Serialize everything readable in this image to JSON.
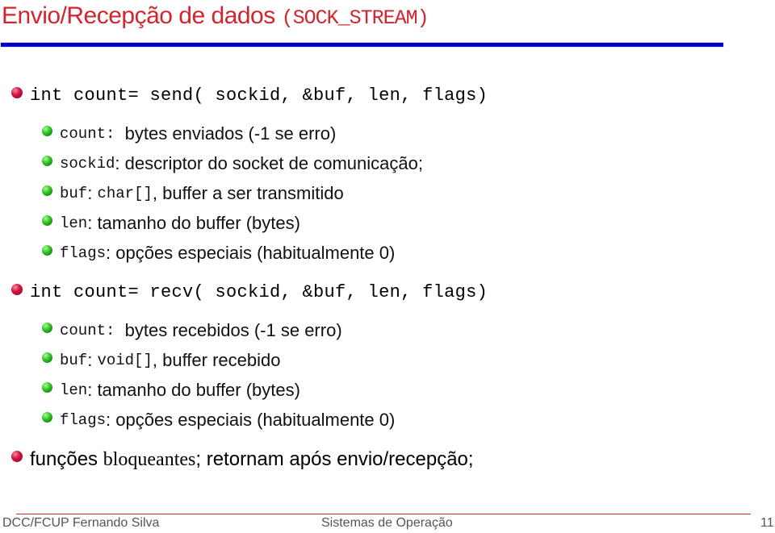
{
  "slide": {
    "title_text": "Envio/Recepção de dados ",
    "title_code": "(SOCK_STREAM)",
    "colors": {
      "title": "#d0262f",
      "rule": "#0000c8",
      "footer_rule": "#d0262f",
      "bullet_level1": "#c8103e",
      "bullet_level2": "#2fbf20"
    },
    "send": {
      "signature": "int count= send( sockid, &buf, len, flags)",
      "items": [
        {
          "code": "count:",
          "text": "  bytes enviados (-1 se erro)"
        },
        {
          "code": "sockid",
          "text": ": descriptor do socket de comunicação;"
        },
        {
          "code": "buf",
          "text": ": ",
          "code2": "char[]",
          "text2": ", buffer a ser transmitido"
        },
        {
          "code": "len",
          "text": ": tamanho do buffer (bytes)"
        },
        {
          "code": "flags",
          "text": ": opções especiais (habitualmente 0)"
        }
      ]
    },
    "recv": {
      "signature": "int count= recv( sockid, &buf, len, flags)",
      "items": [
        {
          "code": "count:",
          "text": "  bytes recebidos (-1 se erro)"
        },
        {
          "code": "buf",
          "text": ": ",
          "code2": "void[]",
          "text2": ", buffer recebido"
        },
        {
          "code": "len",
          "text": ": tamanho do buffer (bytes)"
        },
        {
          "code": "flags",
          "text": ": opções especiais (habitualmente 0)"
        }
      ]
    },
    "note": {
      "prefix": "funções ",
      "emphasis": "bloqueantes",
      "suffix": "; retornam após envio/recepção;"
    }
  },
  "footer": {
    "left": "DCC/FCUP Fernando Silva",
    "center": "Sistemas de Operação",
    "page_number": "11"
  }
}
